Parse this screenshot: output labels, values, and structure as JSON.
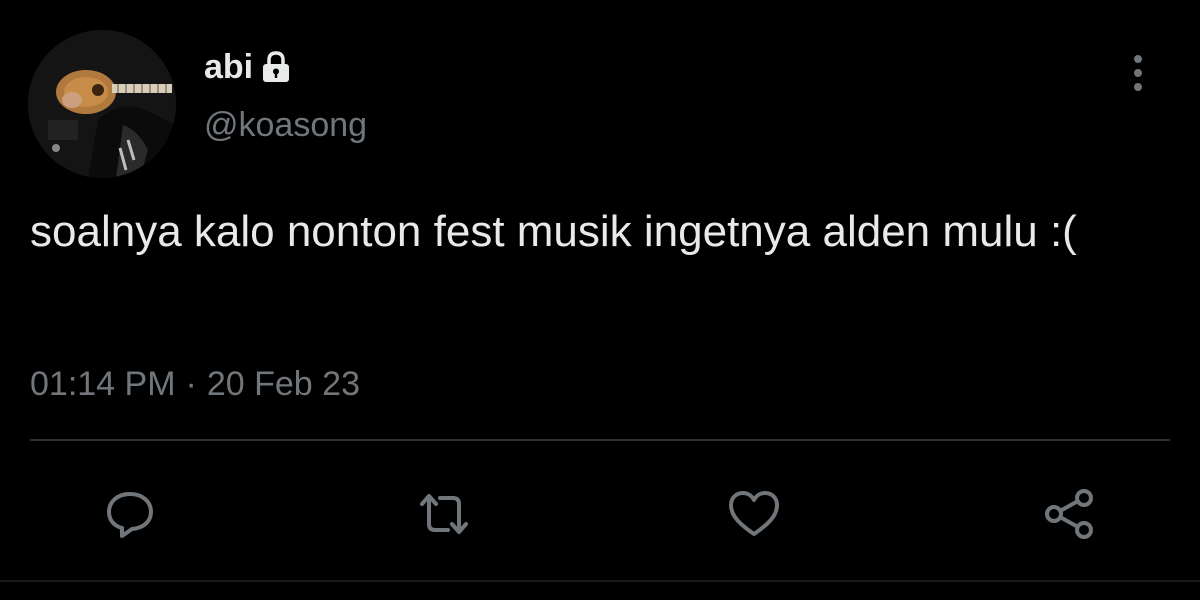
{
  "user": {
    "display_name": "abi",
    "handle": "@koasong",
    "protected": true,
    "avatar_icon": "guitar-player-avatar"
  },
  "tweet": {
    "text": "soalnya kalo nonton fest musik ingetnya alden mulu :(",
    "time": "01:14 PM",
    "separator": "·",
    "date": "20 Feb 23"
  },
  "actions": {
    "reply_icon": "reply-icon",
    "retweet_icon": "retweet-icon",
    "like_icon": "heart-icon",
    "share_icon": "share-icon",
    "more_icon": "more-vertical-icon"
  },
  "colors": {
    "background": "#000000",
    "primary_text": "#e7e9ea",
    "secondary_text": "#71767b",
    "divider": "#2f3336"
  }
}
